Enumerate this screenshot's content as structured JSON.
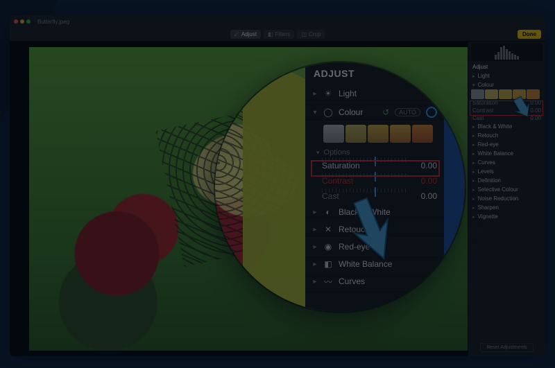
{
  "titlebar": {
    "filename": "Butterfly.jpeg"
  },
  "toolbar": {
    "adjust": "Adjust",
    "filters": "Filters",
    "crop": "Crop",
    "done": "Done"
  },
  "inspector": {
    "adjust_title": "Adjust",
    "light": "Light",
    "colour": "Colour",
    "options": "Options",
    "saturation": {
      "label": "Saturation",
      "value": "0.00"
    },
    "contrast": {
      "label": "Contrast",
      "value": "0.00"
    },
    "cast": {
      "label": "Cast",
      "value": "0.00"
    },
    "black_white": "Black & White",
    "retouch": "Retouch",
    "red_eye": "Red-eye",
    "white_balance": "White Balance",
    "curves": "Curves",
    "levels": "Levels",
    "definition": "Definition",
    "selective_colour": "Selective Colour",
    "noise_reduction": "Noise Reduction",
    "sharpen": "Sharpen",
    "vignette": "Vignette",
    "reset": "Reset Adjustments",
    "auto": "AUTO"
  },
  "magnifier": {
    "title": "ADJUST",
    "light": "Light",
    "colour": "Colour",
    "auto": "AUTO",
    "options": "Options",
    "saturation": {
      "label": "Saturation",
      "value": "0.00"
    },
    "contrast": {
      "label": "Contrast",
      "value": "0.00"
    },
    "cast": {
      "label": "Cast",
      "value": "0.00"
    },
    "black_white": "Black & White",
    "retouch": "Retouch",
    "red_eye": "Red-eye",
    "white_balance": "White Balance",
    "curves": "Curves"
  },
  "colors": {
    "thumbs": [
      "#9a9a9a",
      "#c8bb5e",
      "#d0b23f",
      "#d8a93a",
      "#d98b2a"
    ]
  }
}
